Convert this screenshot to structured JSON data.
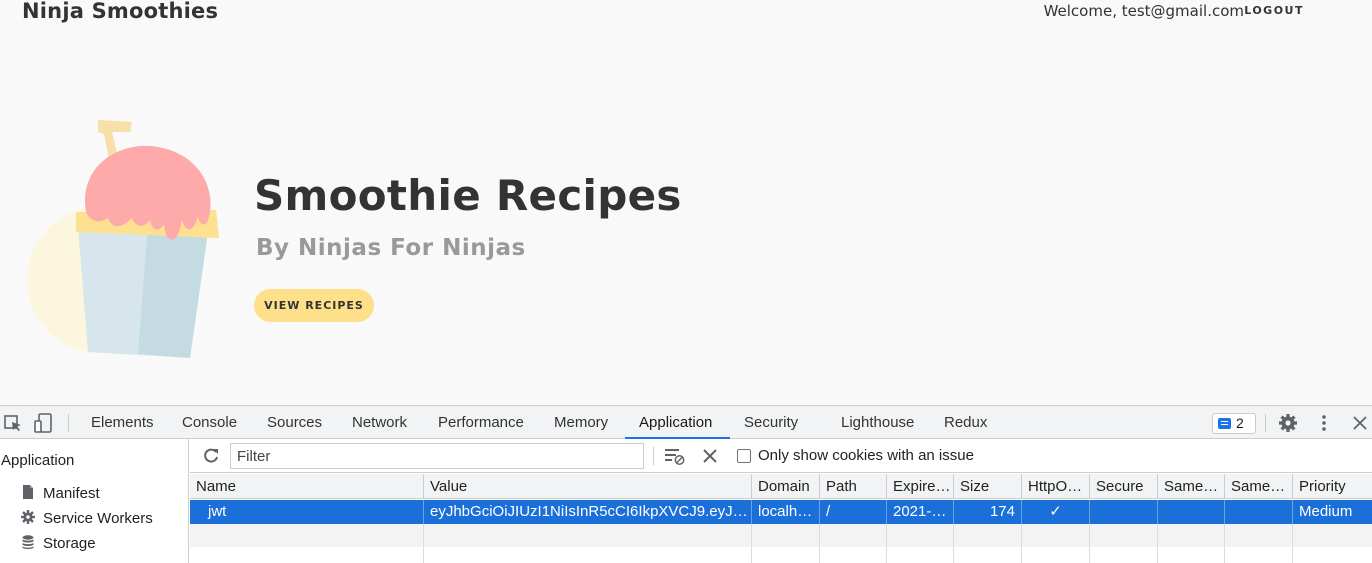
{
  "site": {
    "logo": "Ninja Smoothies",
    "welcome": "Welcome, test@gmail.com",
    "logout": "LOGOUT",
    "hero": {
      "title": "Smoothie Recipes",
      "subtitle": "By Ninjas For Ninjas",
      "cta": "VIEW RECIPES"
    },
    "colors": {
      "accent": "#fee08a",
      "cup": "#d6e6ec",
      "topping": "#ffaaaa"
    }
  },
  "devtools": {
    "tabs": [
      "Elements",
      "Console",
      "Sources",
      "Network",
      "Performance",
      "Memory",
      "Application",
      "Security",
      "Lighthouse",
      "Redux"
    ],
    "active_tab": "Application",
    "issues_count": "2",
    "sidebar": {
      "header": "Application",
      "items": [
        {
          "label": "Manifest",
          "icon": "file-icon"
        },
        {
          "label": "Service Workers",
          "icon": "gear-icon"
        },
        {
          "label": "Storage",
          "icon": "database-icon"
        }
      ]
    },
    "cookies": {
      "filter_placeholder": "Filter",
      "only_issues_label": "Only show cookies with an issue",
      "columns": [
        "Name",
        "Value",
        "Domain",
        "Path",
        "Expire…",
        "Size",
        "HttpO…",
        "Secure",
        "Same…",
        "Same…",
        "Priority"
      ],
      "rows": [
        {
          "name": "jwt",
          "value": "eyJhbGciOiJIUzI1NiIsInR5cCI6IkpXVCJ9.eyJ…",
          "domain": "localh…",
          "path": "/",
          "expires": "2021-…",
          "size": "174",
          "httponly": "✓",
          "secure": "",
          "samesite": "",
          "sameparty": "",
          "priority": "Medium"
        }
      ]
    },
    "colors": {
      "selection": "#1a6fd8",
      "tab_underline": "#1a73e8"
    }
  }
}
